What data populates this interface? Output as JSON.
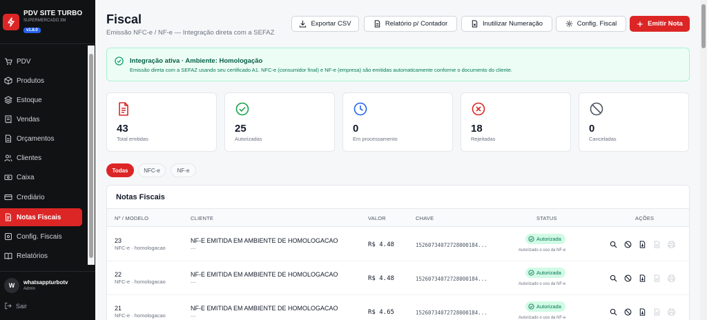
{
  "brand": {
    "title": "PDV SITE TURBO",
    "subtitle": "SUPERMERCADO 3M",
    "version": "v1.8.0"
  },
  "sidebar": {
    "items": [
      {
        "label": "PDV",
        "icon": "cart-icon"
      },
      {
        "label": "Produtos",
        "icon": "box-icon"
      },
      {
        "label": "Estoque",
        "icon": "stack-icon"
      },
      {
        "label": "Vendas",
        "icon": "receipt-icon"
      },
      {
        "label": "Orçamentos",
        "icon": "document-icon"
      },
      {
        "label": "Clientes",
        "icon": "users-icon"
      },
      {
        "label": "Caixa",
        "icon": "cash-icon"
      },
      {
        "label": "Crediário",
        "icon": "card-icon"
      },
      {
        "label": "Notas Fiscais",
        "icon": "invoice-icon",
        "active": true
      },
      {
        "label": "Config. Fiscais",
        "icon": "settings-icon"
      },
      {
        "label": "Relatórios",
        "icon": "book-icon"
      }
    ]
  },
  "user": {
    "initial": "W",
    "name": "whatsappturbotv",
    "role": "Admin"
  },
  "logout": {
    "label": "Sair"
  },
  "header": {
    "title": "Fiscal",
    "subtitle": "Emissão NFC-e / NF-e — Integração direta com a SEFAZ",
    "buttons": {
      "export": "Exportar CSV",
      "report": "Relatório p/ Contador",
      "disable": "Inutilizar Numeração",
      "config": "Config. Fiscal",
      "emit": "Emitir Nota"
    }
  },
  "alert": {
    "title": "Integração ativa · Ambiente: Homologação",
    "text": "Emissão direta com a SEFAZ usando seu certificado A1. NFC-e (consumidor final) e NF-e (empresa) são emitidas automaticamente conforme o documento do cliente."
  },
  "stats": [
    {
      "value": "43",
      "label": "Total emitidas",
      "color": "#dc2626"
    },
    {
      "value": "25",
      "label": "Autorizadas",
      "color": "#16a34a"
    },
    {
      "value": "0",
      "label": "Em processamento",
      "color": "#2563eb"
    },
    {
      "value": "18",
      "label": "Rejeitadas",
      "color": "#dc2626"
    },
    {
      "value": "0",
      "label": "Canceladas",
      "color": "#4b5563"
    }
  ],
  "filters": [
    "Todas",
    "NFC-e",
    "NF-e"
  ],
  "table": {
    "title": "Notas Fiscais",
    "headers": [
      "Nº / MODELO",
      "CLIENTE",
      "VALOR",
      "CHAVE",
      "STATUS",
      "AÇÕES"
    ],
    "rows": [
      {
        "number": "23",
        "model": "NFC-e · homologacao",
        "client": "NF-E EMITIDA EM AMBIENTE DE HOMOLOGACAO",
        "client_sub": "—",
        "value": "R$ 4.48",
        "key": "15260734072728000184...",
        "status": "Autorizada",
        "status_sub": "Autorizado o uso da NF-e"
      },
      {
        "number": "22",
        "model": "NFC-e · homologacao",
        "client": "NF-E EMITIDA EM AMBIENTE DE HOMOLOGACAO",
        "client_sub": "—",
        "value": "R$ 4.48",
        "key": "15260734072728000184...",
        "status": "Autorizada",
        "status_sub": "Autorizado o uso da NF-e"
      },
      {
        "number": "21",
        "model": "NFC-e · homologacao",
        "client": "NF-E EMITIDA EM AMBIENTE DE HOMOLOGACAO",
        "client_sub": "—",
        "value": "R$ 4.65",
        "key": "15260734072728000184...",
        "status": "Autorizada",
        "status_sub": "Autorizado o uso da NF-e"
      }
    ]
  }
}
